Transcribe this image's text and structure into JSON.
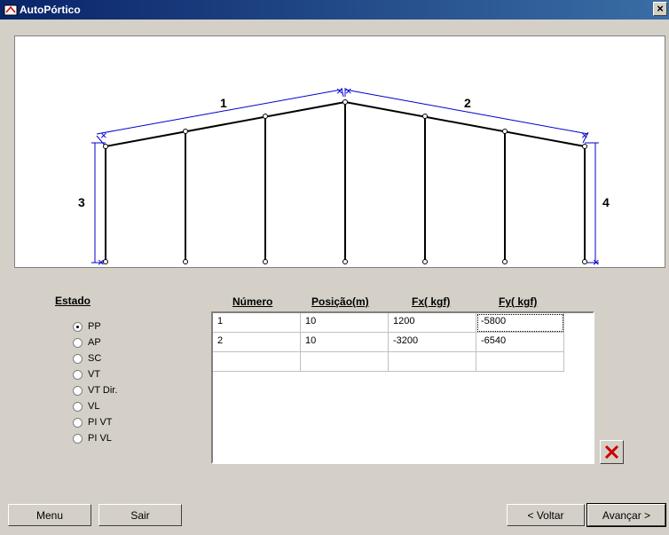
{
  "window": {
    "title": "AutoPórtico",
    "close_label": "×"
  },
  "diagram": {
    "member_labels": [
      "1",
      "2",
      "3",
      "4"
    ],
    "frame_color": "#000000",
    "dimension_color": "#0000cc"
  },
  "estado": {
    "title": "Estado",
    "options": [
      "PP",
      "AP",
      "SC",
      "VT",
      "VT Dir.",
      "VL",
      "PI VT",
      "PI VL"
    ],
    "selected": "PP"
  },
  "table": {
    "headers": [
      "Número",
      "Posição(m)",
      "Fx( kgf)",
      "Fy( kgf)"
    ],
    "rows": [
      [
        "1",
        "10",
        "1200",
        "-5800"
      ],
      [
        "2",
        "10",
        "-3200",
        "-6540"
      ]
    ]
  },
  "buttons": {
    "menu": "Menu",
    "sair": "Sair",
    "voltar": "< Voltar",
    "avancar": "Avançar >"
  },
  "colors": {
    "window_bg": "#d4d0c8",
    "titlebar": "#0a246a",
    "delete_icon": "#cc0000"
  }
}
